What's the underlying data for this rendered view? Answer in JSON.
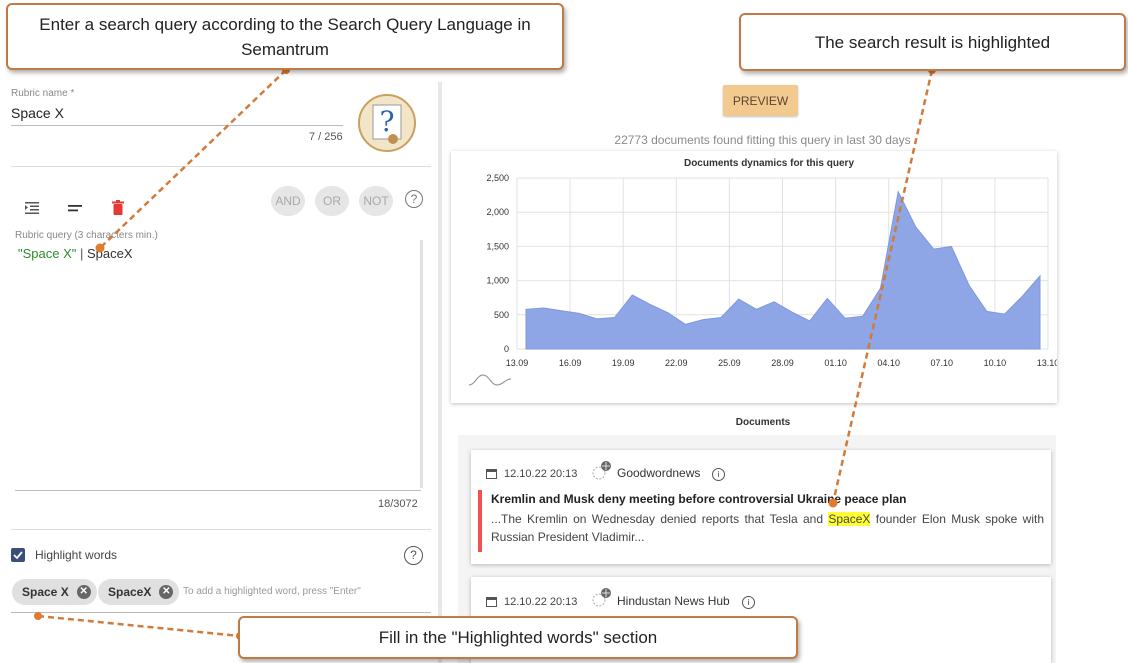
{
  "callouts": {
    "query": "Enter a search query according to the Search Query Language in Semantrum",
    "result": "The search result is highlighted",
    "words": "Fill in the \"Highlighted words\" section"
  },
  "rubric": {
    "name_label": "Rubric name *",
    "name_value": "Space X",
    "name_counter": "7 / 256",
    "query_label": "Rubric query (3 characters min.)",
    "query_part1": "\"Space X\"",
    "query_sep": " | ",
    "query_part2": "SpaceX",
    "query_counter": "18/3072"
  },
  "operators": [
    "AND",
    "OR",
    "NOT"
  ],
  "highlight": {
    "label": "Highlight words",
    "checked": true,
    "chips": [
      "Space X",
      "SpaceX"
    ],
    "placeholder": "To add a highlighted word, press \"Enter\""
  },
  "preview": {
    "button": "PREVIEW",
    "found_text": "22773 documents found fitting this query in last 30 days"
  },
  "chart_data": {
    "type": "area",
    "title": "Documents dynamics for this query",
    "x_ticks": [
      "13.09",
      "16.09",
      "19.09",
      "22.09",
      "25.09",
      "28.09",
      "01.10",
      "04.10",
      "07.10",
      "10.10",
      "13.10"
    ],
    "y_ticks": [
      "0",
      "500",
      "1,000",
      "1,500",
      "2,000",
      "2,500"
    ],
    "ylim": [
      0,
      2500
    ],
    "color": "#8ea5e6",
    "values": [
      580,
      600,
      560,
      520,
      440,
      460,
      790,
      650,
      530,
      360,
      430,
      460,
      730,
      580,
      690,
      540,
      410,
      740,
      450,
      480,
      890,
      2300,
      1780,
      1460,
      1500,
      930,
      550,
      510,
      770,
      1070
    ]
  },
  "documents": {
    "title": "Documents",
    "items": [
      {
        "date": "12.10.22 20:13",
        "source": "Goodwordnews",
        "headline": "Kremlin and Musk deny meeting before controversial Ukraine peace plan",
        "snippet_before": "...The Kremlin on Wednesday denied reports that Tesla and ",
        "snippet_highlight": "SpaceX",
        "snippet_after": " founder Elon Musk spoke with Russian President Vladimir..."
      },
      {
        "date": "12.10.22 20:13",
        "source": "Hindustan News Hub"
      }
    ]
  }
}
